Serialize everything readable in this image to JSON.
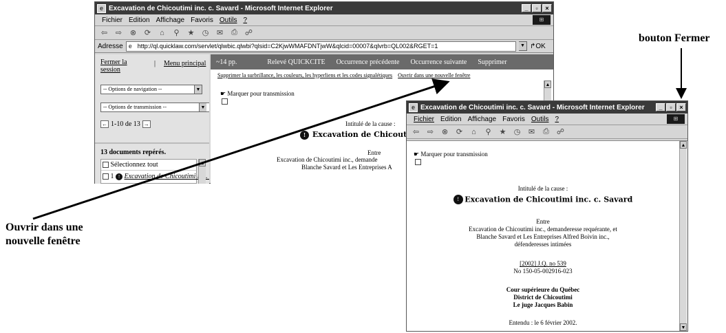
{
  "window1": {
    "title": "Excavation de Chicoutimi inc. c. Savard - Microsoft Internet Explorer",
    "menu": [
      "Fichier",
      "Edition",
      "Affichage",
      "Favoris",
      "Outils",
      "?"
    ],
    "address_label": "Adresse",
    "address_value": "http://ql.quicklaw.com/servlet/qlwbic.qlwbi?qlsid=C2KjwWMAFDNTjwW&qlcid=00007&qlvrb=QL002&RGET=1",
    "go_label": "OK",
    "sidebar": {
      "logout": "Fermer la session",
      "separator": "|",
      "main_menu": "Menu principal",
      "nav_options": "-- Options de navigation --",
      "transmit_options": "-- Options de transmission --",
      "range": "1-10 de 13",
      "docs_found": "13 documents repérés.",
      "select_all": "Sélectionnez tout",
      "item_number": "1",
      "item_title": "Excavation de Chicoutimi inc. c. Savard"
    },
    "topbar": {
      "pages": "~14 pp.",
      "items": [
        "Relevé QUICKCITE",
        "Occurrence précédente",
        "Occurrence suivante",
        "Supprimer"
      ]
    },
    "links": {
      "remove_highlight": "Supprimer la surbrillance, les couleurs, les hyperliens et les codes signalétiques",
      "open_new_window": "Ouvrir dans une nouvelle fenêtre"
    },
    "mark_transmit": "Marquer pour transmission",
    "cause_label": "Intitulé de la cause :",
    "case_title": "Excavation de Chicoutimi",
    "between": "Entre",
    "parties_line1": "Excavation de Chicoutimi inc., demande",
    "parties_line2": "Blanche Savard et Les Entreprises A"
  },
  "window2": {
    "title": "Excavation de Chicoutimi inc. c. Savard - Microsoft Internet Explorer",
    "menu": [
      "Fichier",
      "Edition",
      "Affichage",
      "Favoris",
      "Outils",
      "?"
    ],
    "mark_transmit": "Marquer pour transmission",
    "cause_label": "Intitulé de la cause :",
    "case_title": "Excavation de Chicoutimi inc. c. Savard",
    "between": "Entre",
    "parties_line1": "Excavation de Chicoutimi inc., demanderesse requérante, et",
    "parties_line2": "Blanche Savard et Les Entreprises Alfred Boivin inc.,",
    "parties_line3": "défenderesses intimées",
    "citation": "[2002] J.Q. no 539",
    "docket": "No 150-05-002916-023",
    "court_line1": "Cour supérieure du Québec",
    "court_line2": "District de Chicoutimi",
    "court_line3": "Le juge Jacques Babin",
    "heard": "Entendu : le 6 février 2002."
  },
  "callouts": {
    "close_button": "bouton Fermer",
    "open_new_window_line1": "Ouvrir dans une",
    "open_new_window_line2": "nouvelle fenêtre"
  }
}
